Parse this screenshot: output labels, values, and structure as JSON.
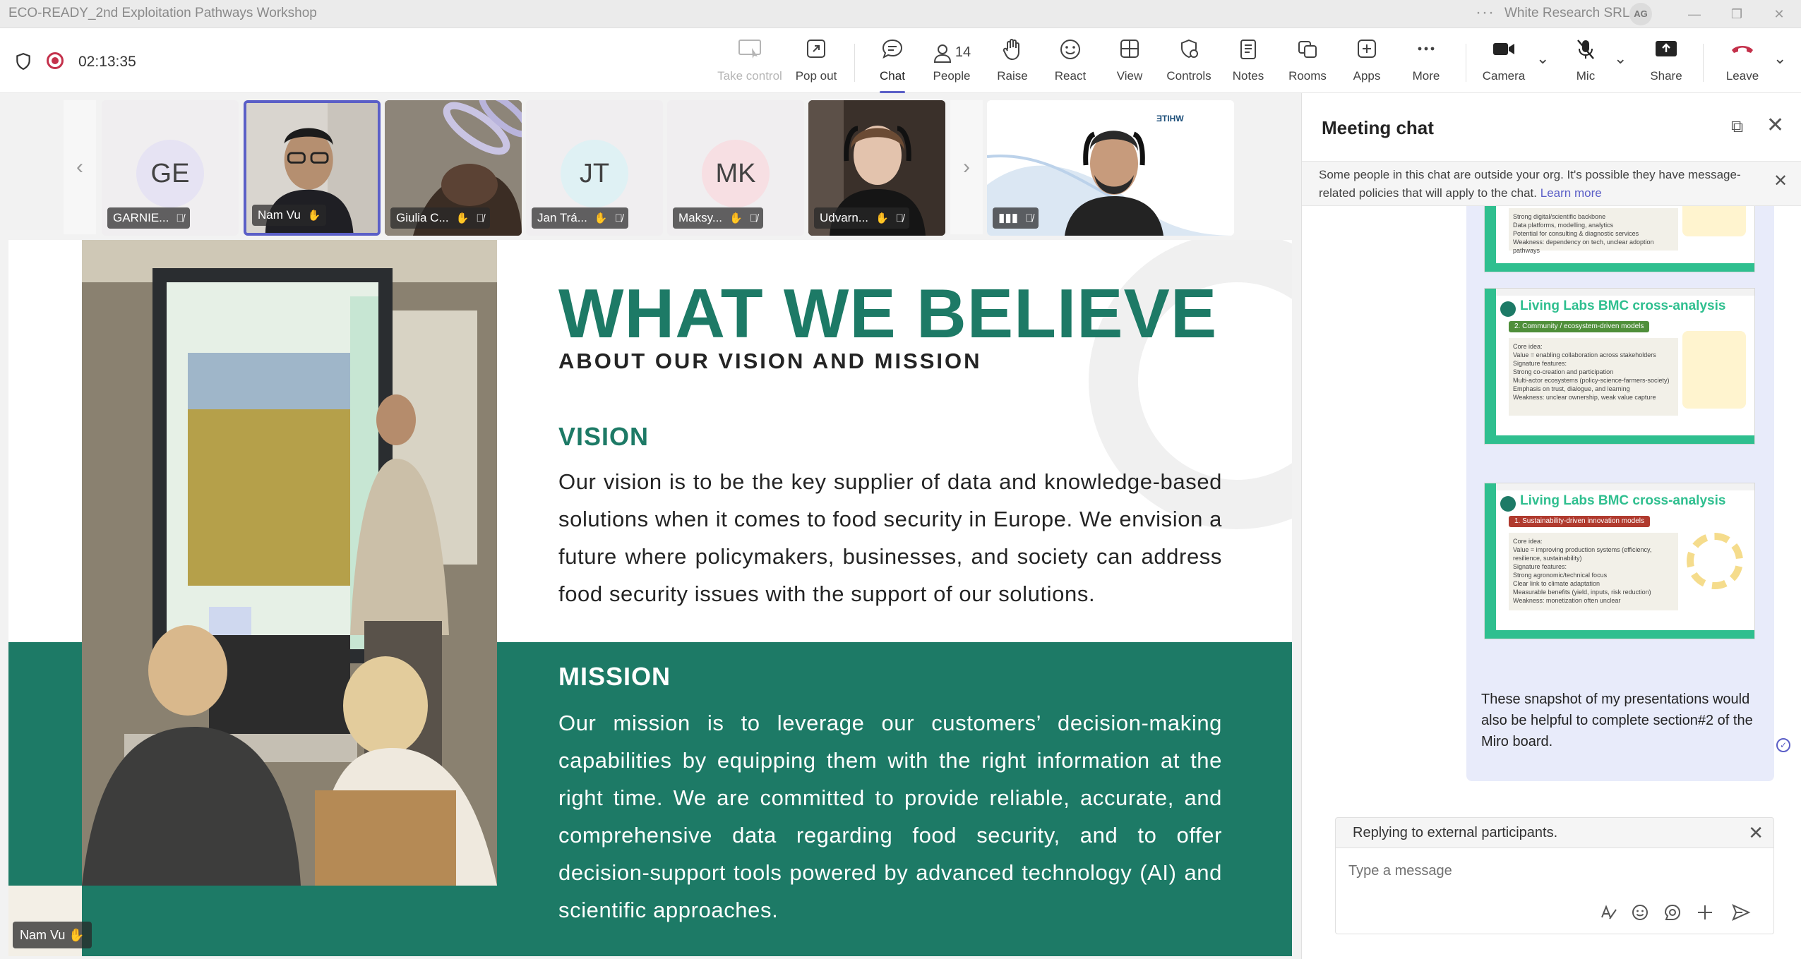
{
  "window": {
    "title": "ECO-READY_2nd Exploitation Pathways Workshop",
    "org": "White Research SRL",
    "user_initials": "AG",
    "more_glyph": "···",
    "minimize_glyph": "—",
    "restore_glyph": "❐",
    "close_glyph": "✕"
  },
  "toolbar": {
    "timer": "02:13:35",
    "take_control": "Take control",
    "pop_out": "Pop out",
    "chat": "Chat",
    "people": "People",
    "people_count": "14",
    "raise": "Raise",
    "react": "React",
    "view": "View",
    "controls": "Controls",
    "notes": "Notes",
    "rooms": "Rooms",
    "apps": "Apps",
    "more": "More",
    "camera": "Camera",
    "mic": "Mic",
    "share": "Share",
    "leave": "Leave",
    "caret_glyph": "⌄"
  },
  "gallery": {
    "prev_glyph": "‹",
    "next_glyph": "›",
    "participants": [
      {
        "initials": "GE",
        "name": "GARNIE...",
        "color": "#e6e3f3"
      },
      {
        "initials": "",
        "name": "Nam Vu"
      },
      {
        "initials": "",
        "name": "Giulia C..."
      },
      {
        "initials": "JT",
        "name": "Jan Trá...",
        "color": "#dff1f4"
      },
      {
        "initials": "MK",
        "name": "Maksy...",
        "color": "#f7dfe3"
      },
      {
        "initials": "",
        "name": "Udvarn..."
      }
    ],
    "speaker_tag": "Nam Vu"
  },
  "slide": {
    "title": "WHAT WE BELIEVE",
    "subtitle": "ABOUT OUR VISION AND MISSION",
    "vision_heading": "VISION",
    "vision_text": "Our vision is to be the key supplier of data and knowledge-based solutions when it comes to food security in Europe. We envision a future where policymakers, businesses, and society can address food security issues with the support of our solutions.",
    "mission_heading": "MISSION",
    "mission_text": "Our mission is to leverage our customers’ decision-making capabilities by equipping them with the right information at the right time. We are committed to provide reliable, accurate, and comprehensive data regarding food security, and to offer decision-support tools powered by advanced technology (AI) and scientific approaches.",
    "colors": {
      "green": "#1d7a66",
      "accent": "#2fbf8f"
    }
  },
  "chat": {
    "title": "Meeting chat",
    "close_glyph": "✕",
    "popout_glyph": "⧉",
    "banner_text": "Some people in this chat are outside your org. It's possible they have message-related policies that will apply to the chat.",
    "banner_link": "Learn more",
    "thumbs": [
      {
        "title": "",
        "pill": "",
        "lines": [
          "Strong digital/scientific backbone",
          "Data platforms, modelling, analytics",
          "Potential for consulting & diagnostic services",
          "Weakness: dependency on tech, unclear adoption pathways"
        ]
      },
      {
        "title": "Living Labs BMC cross-analysis",
        "pill": "2. Community / ecosystem-driven models",
        "pill_color": "#4f8f3a",
        "lines": [
          "Core idea:",
          "Value = enabling collaboration across stakeholders",
          "Signature features:",
          "Strong co-creation and participation",
          "Multi-actor ecosystems (policy-science-farmers-society)",
          "Emphasis on trust, dialogue, and learning",
          "Weakness: unclear ownership, weak value capture"
        ]
      },
      {
        "title": "Living Labs BMC cross-analysis",
        "pill": "1. Sustainability-driven innovation models",
        "pill_color": "#b03a2e",
        "lines": [
          "Core idea:",
          "Value = improving production systems (efficiency, resilience, sustainability)",
          "Signature features:",
          "Strong agronomic/technical focus",
          "Clear link to climate adaptation",
          "Measurable benefits (yield, inputs, risk reduction)",
          "Weakness: monetization often unclear"
        ]
      }
    ],
    "message": "These snapshot of my presentations would also be helpful to complete section#2 of the Miro board.",
    "seen_glyph": "✓",
    "reply_notice": "Replying to external participants.",
    "input_placeholder": "Type a message"
  }
}
